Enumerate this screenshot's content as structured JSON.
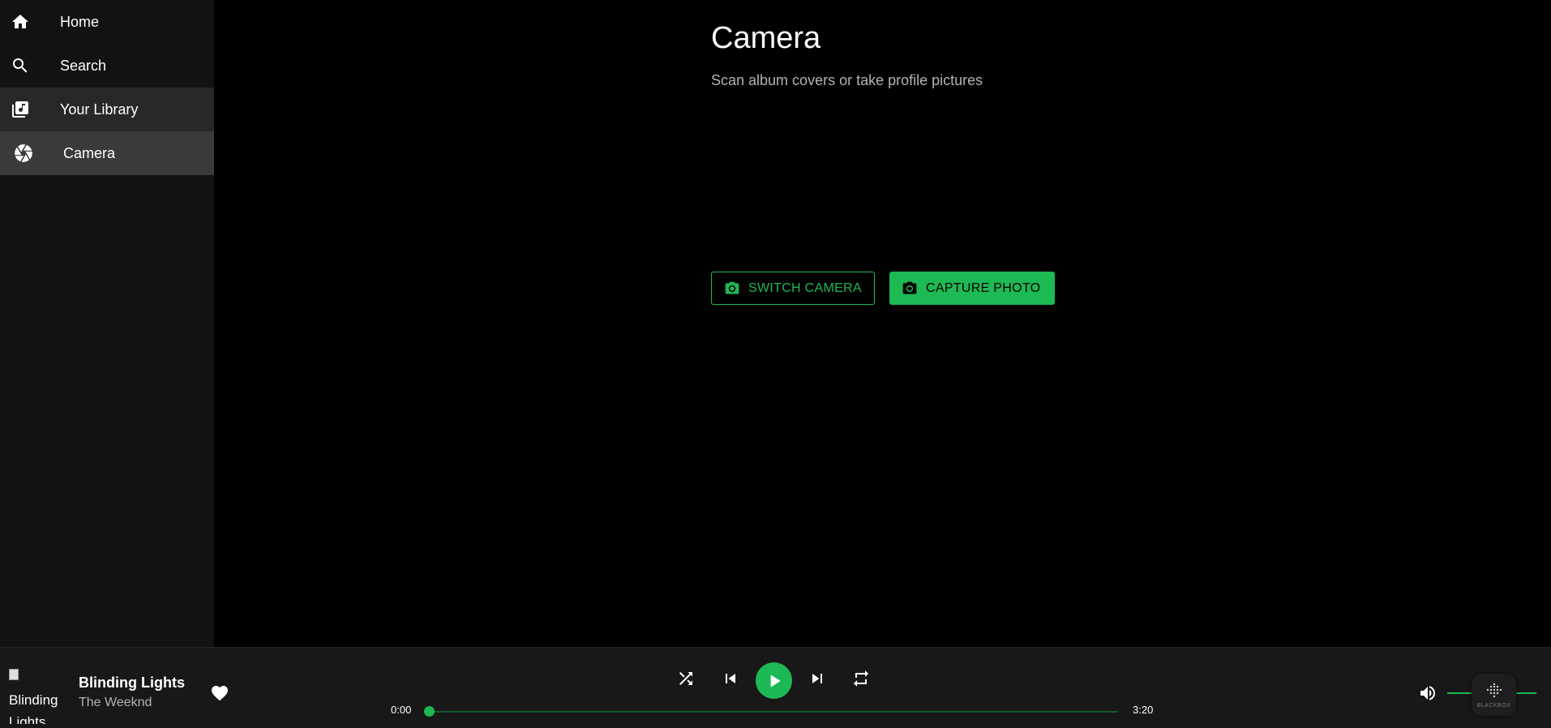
{
  "sidebar": {
    "items": [
      {
        "label": "Home",
        "icon": "home-icon"
      },
      {
        "label": "Search",
        "icon": "search-icon"
      },
      {
        "label": "Your Library",
        "icon": "library-music-icon"
      },
      {
        "label": "Camera",
        "icon": "camera-shutter-icon",
        "active": true
      }
    ]
  },
  "main": {
    "title": "Camera",
    "subtitle": "Scan album covers or take profile pictures",
    "switch_camera_label": "SWITCH CAMERA",
    "capture_photo_label": "CAPTURE PHOTO"
  },
  "player": {
    "album_art_alt": "Blinding Lights",
    "track_title": "Blinding Lights",
    "track_artist": "The Weeknd",
    "current_time": "0:00",
    "total_time": "3:20",
    "progress": 0,
    "volume": 0.5,
    "badge_text": "BLACKBOX"
  },
  "colors": {
    "accent": "#1db954",
    "background": "#000000",
    "sidebar": "#121212",
    "player": "#181818",
    "muted_text": "#b3b3b3"
  }
}
